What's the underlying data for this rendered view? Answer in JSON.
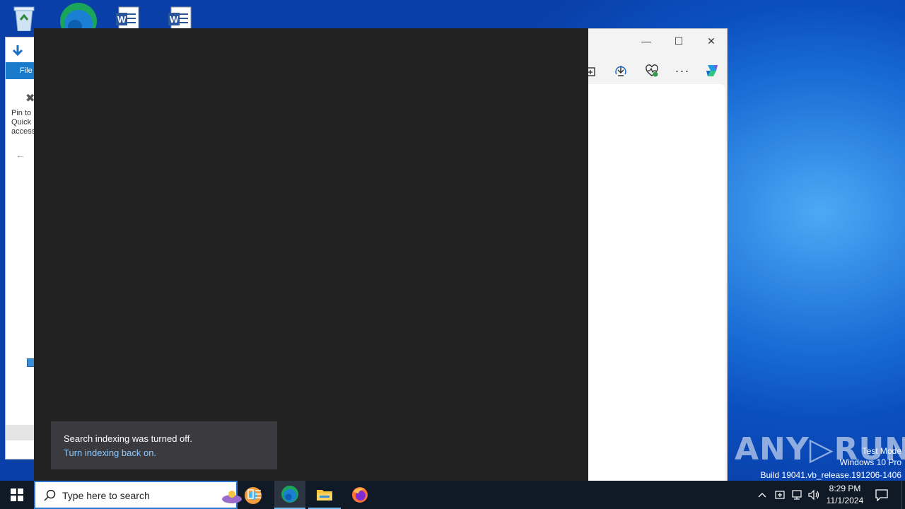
{
  "desktop": {
    "icons": [
      "recycle-bin-icon",
      "edge-icon",
      "word-doc-icon",
      "word-doc-icon"
    ]
  },
  "explorer": {
    "file_tab": "File",
    "pin_label": "Pin to Quick access"
  },
  "edge": {
    "window_controls": {
      "minimize": "—",
      "maximize": "☐",
      "close": "✕"
    },
    "toolbar": {
      "more": "···"
    }
  },
  "toast": {
    "message": "Search indexing was turned off.",
    "link": "Turn indexing back on."
  },
  "watermark": {
    "logo": "ANY▷RUN",
    "line1": "Test Mode",
    "line2": "Windows 10 Pro",
    "line3": "Build 19041.vb_release.191206-1406"
  },
  "taskbar": {
    "search_placeholder": "Type here to search",
    "time": "8:29 PM",
    "date": "11/1/2024",
    "pinned_apps": [
      "task-view",
      "microsoft-edge",
      "file-explorer",
      "firefox"
    ]
  },
  "colors": {
    "taskbar": "#101a26",
    "search_border": "#2a76d2",
    "toast_bg": "#3b3b3f",
    "toast_link": "#8cc8ff",
    "dark_panel": "#222222"
  }
}
